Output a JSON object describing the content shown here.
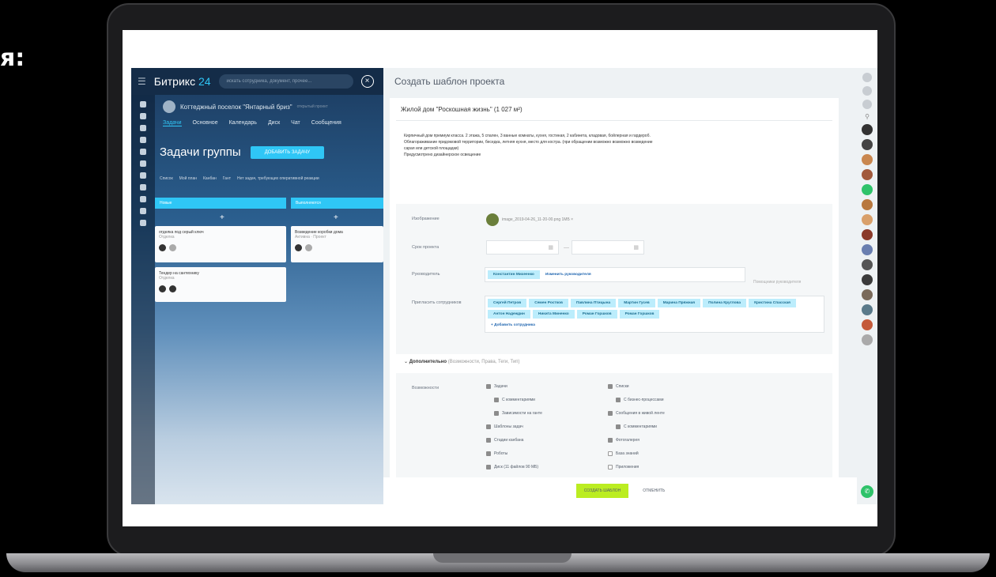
{
  "corner_text": "я:",
  "app": {
    "logo_main": "Битрикс",
    "logo_num": "24",
    "search_placeholder": "искать сотрудника, документ, прочее...",
    "group_name": "Коттеджный поселок \"Янтарный бриз\"",
    "group_sub": "открытый проект",
    "tabs": [
      "Задачи",
      "Основное",
      "Календарь",
      "Диск",
      "Чат",
      "Сообщения"
    ],
    "page_title": "Задачи группы",
    "add_task": "ДОБАВИТЬ ЗАДАЧУ",
    "sub_tabs": [
      "Список",
      "Мой план",
      "Канбан",
      "Гант",
      "Нет задач, требующих оперативной реакции"
    ],
    "columns": [
      "Новые",
      "Выполняются"
    ],
    "cards": [
      {
        "title": "отделка под серый ключ",
        "sub": "Отделка"
      },
      {
        "title": "Возведение коробки дома",
        "sub": "Активна · Проект"
      },
      {
        "title": "Тендер на сантехнику",
        "sub": "Отделка"
      }
    ]
  },
  "panel": {
    "title": "Создать шаблон проекта",
    "project": "Жилой дом \"Роскошная жизнь\" (1 027 м²)",
    "desc": [
      "Кирпичный дом премиум класса. 2 этажа, 5 спален, 3 ванные комнаты, кухня, гостиная, 2 кабинета, кладовая, бойлерная и гардероб.",
      "Облагораживание придомовой территории, беседка, летняя кухня, место для костра. (при обращении возможно возможно возведение",
      "сарая или детской площадки)",
      "Предусмотрено дизайнерское освещение"
    ],
    "labels": {
      "image": "Изображение",
      "deadline": "Срок проекта",
      "owner": "Руководитель",
      "invite": "Пригласить сотрудников",
      "features": "Возможности"
    },
    "file": "image_2019-04-26_11-20-00.png  1МБ ×",
    "owner_tag": "Константин Михеенко",
    "owner_change": "Изменить руководителя",
    "owner_hint": "Помощники руководителя",
    "invitees": [
      "Сергей Петров",
      "Семен Ростков",
      "Павлина Птицына",
      "Мартин Гусев",
      "Марина Пряжная",
      "Полина Круглова",
      "Кристина Спасская",
      "Антон Надеждин",
      "Никита Миненко",
      "Роман Горшков",
      "Роман Горшков"
    ],
    "add_employee": "+ Добавить сотрудника",
    "extra": "Дополнительно",
    "extra_hint": "(Возможности, Права, Теги, Тип)",
    "features_left": [
      {
        "label": "Задачи",
        "on": true,
        "indent": 0
      },
      {
        "label": "С комментариями",
        "on": true,
        "indent": 1
      },
      {
        "label": "Зависимости на ганте",
        "on": true,
        "indent": 1
      },
      {
        "label": "Шаблоны задач",
        "on": true,
        "indent": 0
      },
      {
        "label": "Стадии канбана",
        "on": true,
        "indent": 0
      },
      {
        "label": "Роботы",
        "on": true,
        "indent": 0
      },
      {
        "label": "Диск (11 файлов 90 МБ)",
        "on": true,
        "indent": 0
      }
    ],
    "features_right": [
      {
        "label": "Списки",
        "on": true,
        "indent": 0
      },
      {
        "label": "С бизнес-процессами",
        "on": true,
        "indent": 1
      },
      {
        "label": "Сообщения в живой ленте",
        "on": true,
        "indent": 0
      },
      {
        "label": "С комментариями",
        "on": true,
        "indent": 1
      },
      {
        "label": "Фотогалерея",
        "on": true,
        "indent": 0
      },
      {
        "label": "База знаний",
        "on": false,
        "indent": 0
      },
      {
        "label": "Приложения",
        "on": false,
        "indent": 0
      }
    ],
    "create_btn": "СОЗДАТЬ ШАБЛОН",
    "cancel_btn": "ОТМЕНИТЬ"
  },
  "colors": {
    "accent": "#2fc6f6",
    "create": "#bbed21",
    "tag": "#bcedfc"
  }
}
